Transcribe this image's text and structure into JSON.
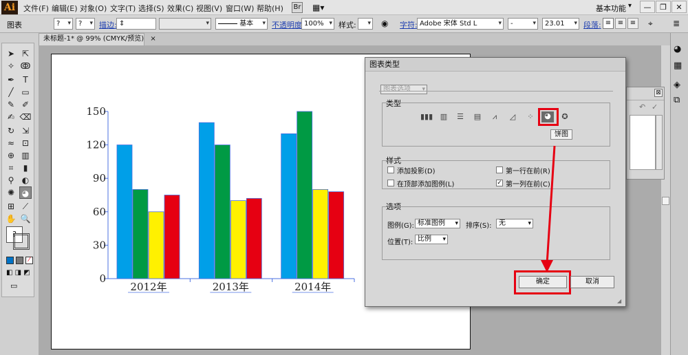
{
  "app": {
    "logo": "Ai",
    "workspace": "基本功能"
  },
  "menu": [
    "文件(F)",
    "编辑(E)",
    "对象(O)",
    "文字(T)",
    "选择(S)",
    "效果(C)",
    "视图(V)",
    "窗口(W)",
    "帮助(H)"
  ],
  "control_bar": {
    "object_type": "图表",
    "stroke_label": "描边:",
    "stroke_profile": "基本",
    "opacity_label": "不透明度:",
    "opacity_value": "100%",
    "style_label": "样式:",
    "char_label": "字符:",
    "font_name": "Adobe 宋体 Std L",
    "font_style": "-",
    "font_size": "23.01",
    "para_label": "段落:"
  },
  "document_tab": {
    "title": "未标题-1* @ 99% (CMYK/预览)",
    "close": "×"
  },
  "window_controls": {
    "minimize": "—",
    "restore": "❐",
    "close": "✕"
  },
  "chart_data": {
    "type": "bar",
    "categories": [
      "2012年",
      "2013年",
      "2014年"
    ],
    "series": [
      {
        "values": [
          120,
          140,
          130
        ],
        "color": "#009fe8"
      },
      {
        "values": [
          80,
          120,
          150
        ],
        "color": "#009a44"
      },
      {
        "values": [
          60,
          70,
          80
        ],
        "color": "#fff100"
      },
      {
        "values": [
          75,
          72,
          78
        ],
        "color": "#e60012"
      }
    ],
    "yticks": [
      "0",
      "30",
      "60",
      "90",
      "120",
      "150"
    ],
    "ylim": [
      0,
      150
    ]
  },
  "dialog": {
    "title": "图表类型",
    "top_select": "图表选项",
    "type_group": "类型",
    "style_group": "样式",
    "style_options": [
      {
        "label": "添加投影(D)",
        "checked": false
      },
      {
        "label": "第一行在前(R)",
        "checked": false
      },
      {
        "label": "在顶部添加图例(L)",
        "checked": false
      },
      {
        "label": "第一列在前(C)",
        "checked": true
      }
    ],
    "options_group": "选项",
    "legend_label": "图例(G):",
    "legend_value": "标准图例",
    "sort_label": "排序(S):",
    "sort_value": "无",
    "position_label": "位置(T):",
    "position_value": "比例",
    "ok_label": "确定",
    "cancel_label": "取消",
    "tooltip": "饼图",
    "check_mark": "✓"
  },
  "accent": {
    "highlight": "#e60012"
  }
}
